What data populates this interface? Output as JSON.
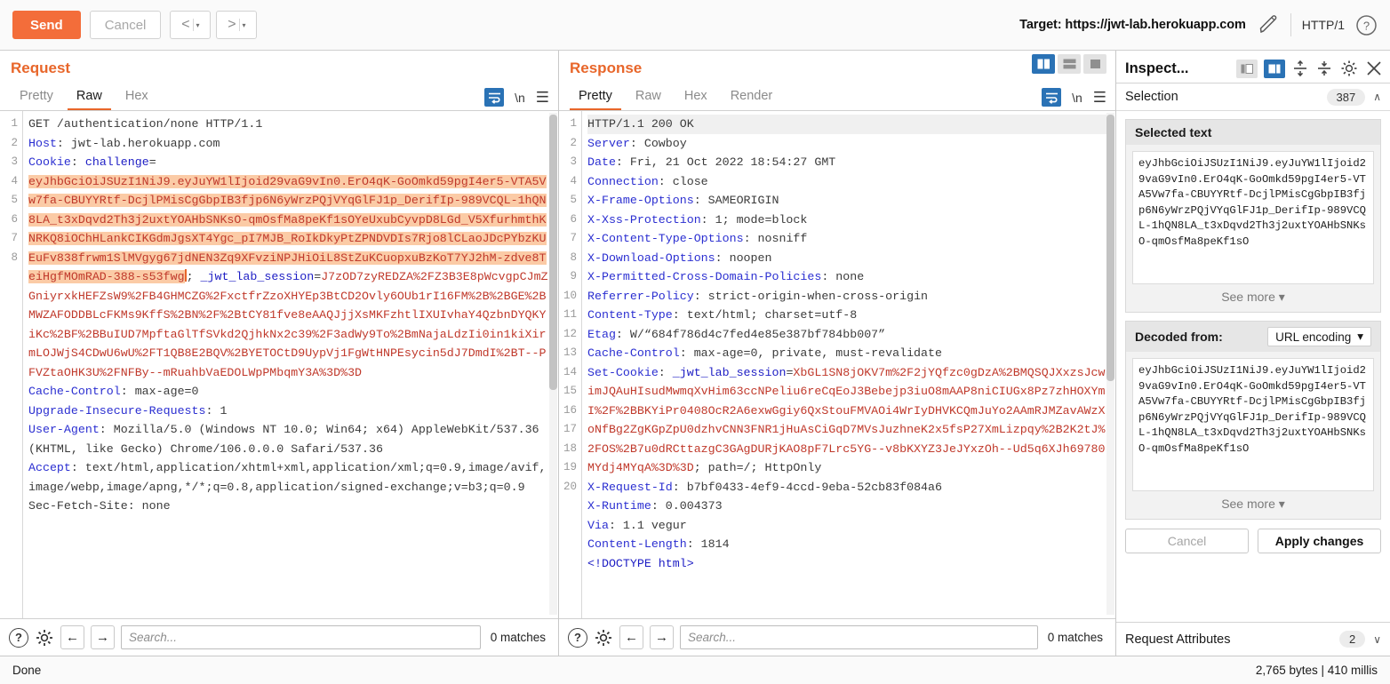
{
  "toolbar": {
    "send_label": "Send",
    "cancel_label": "Cancel",
    "back_arrow": "<",
    "forward_arrow": ">",
    "caret": "▾",
    "target_label": "Target: https://jwt-lab.herokuapp.com",
    "edit_icon": "pencil-icon",
    "http_version": "HTTP/1",
    "help_icon": "question-mark-icon",
    "accent_color": "#f36d3a"
  },
  "request": {
    "title": "Request",
    "tabs": [
      "Pretty",
      "Raw",
      "Hex"
    ],
    "active_tab": "Raw",
    "wrap_icon": "word-wrap-icon",
    "newline_label": "\\n",
    "menu_icon": "hamburger-menu-icon",
    "lines": [
      {
        "n": "1",
        "segments": [
          {
            "t": "GET /authentication/none HTTP/1.1",
            "c": "val"
          }
        ]
      },
      {
        "n": "2",
        "segments": [
          {
            "t": "Host",
            "c": "hdr-name"
          },
          {
            "t": ": jwt-lab.herokuapp.com",
            "c": "val"
          }
        ]
      },
      {
        "n": "3",
        "segments": [
          {
            "t": "Cookie",
            "c": "hdr-name"
          },
          {
            "t": ": ",
            "c": "val"
          },
          {
            "t": "challenge",
            "c": "blue-strong"
          },
          {
            "t": "=",
            "c": "val"
          }
        ]
      },
      {
        "n": "",
        "segments": [
          {
            "t": "eyJhbGciOiJSUzI1NiJ9.eyJuYW1lIjoid29vaG9vIn0.ErO4qK-GoOmkd59pgI4er5-VTA5Vw7fa-CBUYYRtf-DcjlPMisCgGbpIB3fjp6N6yWrzPQjVYqGlFJ1p_DerifIp-989VCQL-1hQN8LA_t3xDqvd2Th3j2uxtYOAHbSNKsO-qmOsfMa8peKf1sOYeUxubCyvpD8LGd_V5XfurhmthKNRKQ8iOChHLankCIKGdmJgsXT4Ygc_pI7MJB_RoIkDkyPtZPNDVDIs7Rjo8lCLaoJDcPYbzKUEuFv838frwm1SlMVgyg67jdNEN3Zq9XFvziNPJHiOiL8StZuKCuopxuBzKoT7YJ2hM-zdve8TeiHgfMOmRAD-388-s53fwg",
            "c": "sel-hl"
          },
          {
            "t": "▮",
            "c": "caret"
          },
          {
            "t": "; ",
            "c": "val"
          },
          {
            "t": "_jwt_lab_session",
            "c": "blue-strong"
          },
          {
            "t": "=",
            "c": "val"
          },
          {
            "t": "J7zOD7zyREDZA%2FZ3B3E8pWcvgpCJmZGniyrxkHEFZsW9%2FB4GHMCZG%2FxctfrZzoXHYEp3BtCD2Ovly6OUb1rI16FM%2B%2BGE%2BMWZAFODDBLcFKMs9KffS%2BN%2F%2BtCY81fve8eAAQJjjXsMKFzhtlIXUIvhaY4QzbnDYQKYiKc%2BF%2BBuIUD7MpftaGlTfSVkd2QjhkNx2c39%2F3adWy9To%2BmNajaLdzIi0in1kiXirmLOJWjS4CDwU6wU%2FT1QB8E2BQV%2BYETOCtD9UypVj1FgWtHNPEsycin5dJ7DmdI%2BT--PFVZtaOHK3U%2FNFBy--mRuahbVaEDOLWpPMbqmY3A%3D%3D",
            "c": "red"
          }
        ]
      },
      {
        "n": "4",
        "segments": [
          {
            "t": "Cache-Control",
            "c": "hdr-name"
          },
          {
            "t": ": max-age=0",
            "c": "val"
          }
        ]
      },
      {
        "n": "5",
        "segments": [
          {
            "t": "Upgrade-Insecure-Requests",
            "c": "hdr-name"
          },
          {
            "t": ": 1",
            "c": "val"
          }
        ]
      },
      {
        "n": "6",
        "segments": [
          {
            "t": "User-Agent",
            "c": "hdr-name"
          },
          {
            "t": ": Mozilla/5.0 (Windows NT 10.0; Win64; x64) AppleWebKit/537.36 (KHTML, like Gecko) Chrome/106.0.0.0 Safari/537.36",
            "c": "val"
          }
        ]
      },
      {
        "n": "7",
        "segments": [
          {
            "t": "Accept",
            "c": "hdr-name"
          },
          {
            "t": ": text/html,application/xhtml+xml,application/xml;q=0.9,image/avif,image/webp,image/apng,*/*;q=0.8,application/signed-exchange;v=b3;q=0.9",
            "c": "val"
          }
        ]
      },
      {
        "n": "8",
        "segments": [
          {
            "t": "Sec-Fetch-Site: none",
            "c": "val"
          }
        ]
      }
    ],
    "search_placeholder": "Search...",
    "matches": "0 matches",
    "help_icon": "question-mark-icon",
    "settings_icon": "gear-icon",
    "prev_icon": "arrow-left-icon",
    "next_icon": "arrow-right-icon"
  },
  "response": {
    "title": "Response",
    "tabs": [
      "Pretty",
      "Raw",
      "Hex",
      "Render"
    ],
    "active_tab": "Pretty",
    "layout_icons": [
      "split-vertical-icon",
      "split-horizontal-icon",
      "single-pane-icon"
    ],
    "active_layout": 0,
    "wrap_icon": "word-wrap-icon",
    "newline_label": "\\n",
    "menu_icon": "hamburger-menu-icon",
    "lines": [
      {
        "n": "1",
        "first": true,
        "segments": [
          {
            "t": "HTTP/1.1 200 OK",
            "c": "val"
          }
        ]
      },
      {
        "n": "2",
        "segments": [
          {
            "t": "Server",
            "c": "hdr-name"
          },
          {
            "t": ": Cowboy",
            "c": "val"
          }
        ]
      },
      {
        "n": "3",
        "segments": [
          {
            "t": "Date",
            "c": "hdr-name"
          },
          {
            "t": ": Fri, 21 Oct 2022 18:54:27 GMT",
            "c": "val"
          }
        ]
      },
      {
        "n": "4",
        "segments": [
          {
            "t": "Connection",
            "c": "hdr-name"
          },
          {
            "t": ": close",
            "c": "val"
          }
        ]
      },
      {
        "n": "5",
        "segments": [
          {
            "t": "X-Frame-Options",
            "c": "hdr-name"
          },
          {
            "t": ": SAMEORIGIN",
            "c": "val"
          }
        ]
      },
      {
        "n": "6",
        "segments": [
          {
            "t": "X-Xss-Protection",
            "c": "hdr-name"
          },
          {
            "t": ": 1; mode=block",
            "c": "val"
          }
        ]
      },
      {
        "n": "7",
        "segments": [
          {
            "t": "X-Content-Type-Options",
            "c": "hdr-name"
          },
          {
            "t": ": nosniff",
            "c": "val"
          }
        ]
      },
      {
        "n": "8",
        "segments": [
          {
            "t": "X-Download-Options",
            "c": "hdr-name"
          },
          {
            "t": ": noopen",
            "c": "val"
          }
        ]
      },
      {
        "n": "9",
        "segments": [
          {
            "t": "X-Permitted-Cross-Domain-Policies",
            "c": "hdr-name"
          },
          {
            "t": ": none",
            "c": "val"
          }
        ]
      },
      {
        "n": "10",
        "segments": [
          {
            "t": "Referrer-Policy",
            "c": "hdr-name"
          },
          {
            "t": ": strict-origin-when-cross-origin",
            "c": "val"
          }
        ]
      },
      {
        "n": "11",
        "segments": [
          {
            "t": "Content-Type",
            "c": "hdr-name"
          },
          {
            "t": ": text/html; charset=utf-8",
            "c": "val"
          }
        ]
      },
      {
        "n": "12",
        "segments": [
          {
            "t": "Etag",
            "c": "hdr-name"
          },
          {
            "t": ": W/“684f786d4c7fed4e85e387bf784bb007”",
            "c": "val"
          }
        ]
      },
      {
        "n": "13",
        "segments": [
          {
            "t": "Cache-Control",
            "c": "hdr-name"
          },
          {
            "t": ": max-age=0, private, must-revalidate",
            "c": "val"
          }
        ]
      },
      {
        "n": "14",
        "segments": [
          {
            "t": "Set-Cookie",
            "c": "hdr-name"
          },
          {
            "t": ": ",
            "c": "val"
          },
          {
            "t": "_jwt_lab_session",
            "c": "blue-strong"
          },
          {
            "t": "=",
            "c": "val"
          },
          {
            "t": "XbGL1SN8jOKV7m%2F2jYQfzc0gDzA%2BMQSQJXxzsJcwimJQAuHIsudMwmqXvHim63ccNPeliu6reCqEoJ3Bebejp3iuO8mAAP8niCIUGx8Pz7zhHOXYmI%2F%2BBKYiPr0408OcR2A6exwGgiy6QxStouFMVAOi4WrIyDHVKCQmJuYo2AAmRJMZavAWzXoNfBg2ZgKGpZpU0dzhvCNN3FNR1jHuAsCiGqD7MVsJuzhneK2x5fsP27XmLizpqy%2B2K2tJ%2FOS%2B7u0dRCttazgC3GAgDURjKAO8pF7Lrc5YG--v8bKXYZ3JeJYxzOh--Ud5q6XJh69780MYdj4MYqA%3D%3D",
            "c": "red"
          },
          {
            "t": "; path=/; HttpOnly",
            "c": "val"
          }
        ]
      },
      {
        "n": "15",
        "segments": [
          {
            "t": "X-Request-Id",
            "c": "hdr-name"
          },
          {
            "t": ": b7bf0433-4ef9-4ccd-9eba-52cb83f084a6",
            "c": "val"
          }
        ]
      },
      {
        "n": "16",
        "segments": [
          {
            "t": "X-Runtime",
            "c": "hdr-name"
          },
          {
            "t": ": 0.004373",
            "c": "val"
          }
        ]
      },
      {
        "n": "17",
        "segments": [
          {
            "t": "Via",
            "c": "hdr-name"
          },
          {
            "t": ": 1.1 vegur",
            "c": "val"
          }
        ]
      },
      {
        "n": "18",
        "segments": [
          {
            "t": "Content-Length",
            "c": "hdr-name"
          },
          {
            "t": ": 1814",
            "c": "val"
          }
        ]
      },
      {
        "n": "19",
        "segments": [
          {
            "t": "",
            "c": "val"
          }
        ]
      },
      {
        "n": "20",
        "segments": [
          {
            "t": "<!DOCTYPE html>",
            "c": "blue-strong"
          }
        ]
      }
    ],
    "search_placeholder": "Search...",
    "matches": "0 matches",
    "help_icon": "question-mark-icon",
    "settings_icon": "gear-icon",
    "prev_icon": "arrow-left-icon",
    "next_icon": "arrow-right-icon"
  },
  "inspector": {
    "title": "Inspect...",
    "layout_icons": [
      "dock-left-icon",
      "dock-right-icon"
    ],
    "active_layout": 1,
    "expand_icon": "expand-all-icon",
    "collapse_icon": "collapse-all-icon",
    "settings_icon": "gear-icon",
    "close_icon": "close-icon",
    "selection": {
      "label": "Selection",
      "count": "387",
      "chevron": "∧",
      "selected_text_label": "Selected text",
      "selected_text": "eyJhbGciOiJSUzI1NiJ9.eyJuYW1lIjoid29vaG9vIn0.ErO4qK-GoOmkd59pgI4er5-VTA5Vw7fa-CBUYYRtf-DcjlPMisCgGbpIB3fjp6N6yWrzPQjVYqGlFJ1p_DerifIp-989VCQL-1hQN8LA_t3xDqvd2Th3j2uxtYOAHbSNKsO-qmOsfMa8peKf1sO",
      "see_more": "See more",
      "decoded_label": "Decoded from:",
      "decoded_mode": "URL encoding",
      "decoded_text": "eyJhbGciOiJSUzI1NiJ9.eyJuYW1lIjoid29vaG9vIn0.ErO4qK-GoOmkd59pgI4er5-VTA5Vw7fa-CBUYYRtf-DcjlPMisCgGbpIB3fjp6N6yWrzPQjVYqGlFJ1p_DerifIp-989VCQL-1hQN8LA_t3xDqvd2Th3j2uxtYOAHbSNKsO-qmOsfMa8peKf1sO",
      "see_more_2": "See more",
      "cancel_label": "Cancel",
      "apply_label": "Apply changes"
    },
    "request_attributes": {
      "label": "Request Attributes",
      "count": "2",
      "chevron": "∨"
    }
  },
  "statusbar": {
    "left": "Done",
    "right": "2,765 bytes | 410 millis"
  }
}
